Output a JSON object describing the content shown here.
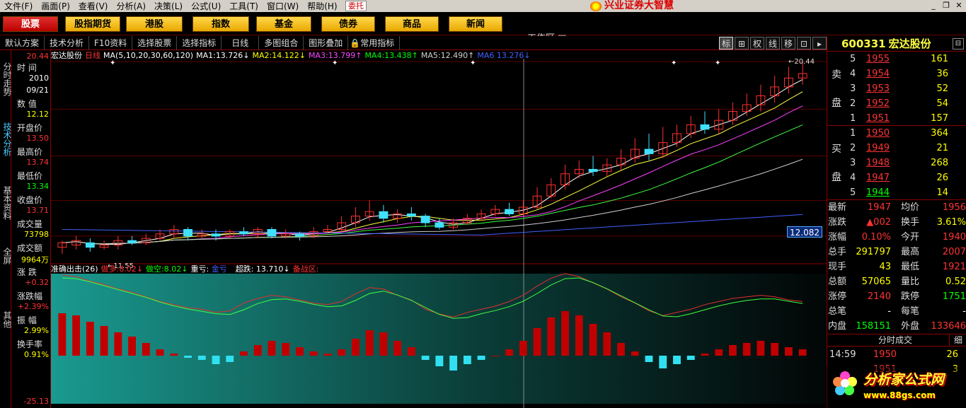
{
  "menu": [
    "文件(F)",
    "画面(P)",
    "查看(V)",
    "分析(A)",
    "决策(L)",
    "公式(U)",
    "工具(T)",
    "窗口(W)",
    "帮助(H)"
  ],
  "menu_weituo": "委托",
  "brand": "兴业证券大智慧",
  "window_buttons": {
    "min": "_",
    "restore": "❐",
    "close": "✕"
  },
  "quick_buttons": [
    "股票",
    "股指期货",
    "港股",
    "指数",
    "基金",
    "债券",
    "商品",
    "新闻"
  ],
  "workzone": "工作区 ▣",
  "toolbar": {
    "items": [
      "默认方案",
      "技术分析",
      "F10资料",
      "选择股票",
      "选择指标",
      "日线",
      "多图组合",
      "图形叠加",
      "常用指标"
    ],
    "right_buttons": [
      "标",
      "⊞",
      "权",
      "线",
      "移",
      "⊡",
      "▸"
    ]
  },
  "left_tabs": [
    "分时走势",
    "技术分析",
    "基本资料",
    "全屏",
    "其他"
  ],
  "sidebar": {
    "top_value": "20.44",
    "time_label": "时  间",
    "year": "2010",
    "date": "09/21",
    "value_label": "数  值",
    "value": "12.12",
    "open_label": "开盘价",
    "open": "13.50",
    "high_label": "最高价",
    "high": "13.74",
    "low_label": "最低价",
    "low": "13.34",
    "close_label": "收盘价",
    "close": "13.71",
    "volume_label": "成交量",
    "volume": "73798",
    "amount_label": "成交额",
    "amount": "9964万",
    "change_label": "涨  跌",
    "change": "+0.32",
    "changepct_label": "涨跌幅",
    "changepct": "+2.39%",
    "amplitude_label": "振  幅",
    "amplitude": "2.99%",
    "turnover_label": "换手率",
    "turnover": "0.91%",
    "bottom_value": "-25.13"
  },
  "chart_header": {
    "stock": "宏达股份",
    "period": "日线",
    "ma_params": "MA(5,10,20,30,60,120)",
    "ma": [
      {
        "label": "MA1:",
        "value": "13.726",
        "arrow": "↓",
        "color": "#ffffff"
      },
      {
        "label": "MA2:",
        "value": "14.122",
        "arrow": "↓",
        "color": "#ffff40"
      },
      {
        "label": "MA3:",
        "value": "13.799",
        "arrow": "↑",
        "color": "#ff40ff"
      },
      {
        "label": "MA4:",
        "value": "13.438",
        "arrow": "↑",
        "color": "#40ff40"
      },
      {
        "label": "MA5:",
        "value": "12.490",
        "arrow": "↑",
        "color": "#d0d0d0"
      },
      {
        "label": "MA6",
        "value": "13.276",
        "arrow": "↓",
        "color": "#4060ff"
      }
    ],
    "high_mark": "20.44",
    "low_mark": "11.55",
    "price_box": "12.082"
  },
  "indicator_header": {
    "name": "准确出击(26)",
    "items": [
      {
        "label": "做多:",
        "value": "8.02",
        "arrow": "↓",
        "color": "#ff3030"
      },
      {
        "label": "做空:",
        "value": "8.02",
        "arrow": "↓",
        "color": "#30ff30"
      },
      {
        "label": "重亏:",
        "value": "金亏",
        "arrow": "",
        "color": "#4060ff"
      },
      {
        "label": "超跌:",
        "value": "13.710",
        "arrow": "↓",
        "color": "#ffffff"
      },
      {
        "label": "备战区:",
        "value": "",
        "arrow": "",
        "color": "#ff3030"
      }
    ]
  },
  "right_panel": {
    "code": "600331",
    "name": "宏达股份",
    "sell_label": [
      "卖",
      "盘"
    ],
    "buy_label": [
      "买",
      "盘"
    ],
    "asks": [
      {
        "level": "5",
        "price": "1955",
        "vol": "161"
      },
      {
        "level": "4",
        "price": "1954",
        "vol": "36"
      },
      {
        "level": "3",
        "price": "1953",
        "vol": "52"
      },
      {
        "level": "2",
        "price": "1952",
        "vol": "54"
      },
      {
        "level": "1",
        "price": "1951",
        "vol": "157"
      }
    ],
    "bids": [
      {
        "level": "1",
        "price": "1950",
        "vol": "364"
      },
      {
        "level": "2",
        "price": "1949",
        "vol": "21"
      },
      {
        "level": "3",
        "price": "1948",
        "vol": "268"
      },
      {
        "level": "4",
        "price": "1947",
        "vol": "26"
      },
      {
        "level": "5",
        "price": "1944",
        "vol": "14"
      }
    ],
    "quote": [
      {
        "l1": "最新",
        "v1": "1947",
        "c1": "red",
        "l2": "均价",
        "v2": "1956",
        "c2": "red"
      },
      {
        "l1": "涨跌",
        "v1": "▲002",
        "c1": "red",
        "l2": "换手",
        "v2": "3.61%",
        "c2": "yel"
      },
      {
        "l1": "涨幅",
        "v1": "0.10%",
        "c1": "red",
        "l2": "今开",
        "v2": "1940",
        "c2": "red"
      },
      {
        "l1": "总手",
        "v1": "291797",
        "c1": "yel",
        "l2": "最高",
        "v2": "2007",
        "c2": "red"
      },
      {
        "l1": "现手",
        "v1": "43",
        "c1": "yel",
        "l2": "最低",
        "v2": "1921",
        "c2": "red"
      },
      {
        "l1": "总额",
        "v1": "57065",
        "c1": "yel",
        "l2": "量比",
        "v2": "0.52",
        "c2": "yel"
      },
      {
        "l1": "涨停",
        "v1": "2140",
        "c1": "red",
        "l2": "跌停",
        "v2": "1751",
        "c2": "grn"
      },
      {
        "l1": "总笔",
        "v1": "-",
        "c1": "wht",
        "l2": "每笔",
        "v2": "-",
        "c2": "wht"
      },
      {
        "l1": "内盘",
        "v1": "158151",
        "c1": "grn",
        "l2": "外盘",
        "v2": "133646",
        "c2": "red"
      }
    ],
    "tick_title": "分时成交",
    "tick_detail": "细",
    "ticks": [
      {
        "time": "14:59",
        "price": "1950",
        "vol": "26"
      },
      {
        "time": "",
        "price": "1951",
        "vol": "3"
      }
    ]
  },
  "watermark": {
    "title": "分析家公式网",
    "url": "www.88gs.com"
  },
  "colors": {
    "up": "#ff3030",
    "down": "#40e0ff",
    "ma1": "#ffffff",
    "ma2": "#ffff40",
    "ma3": "#ff40ff",
    "ma4": "#40ff40",
    "ma5": "#d0d0d0",
    "ma6": "#4060ff",
    "bg": "#000000"
  },
  "chart_data": {
    "type": "candlestick+macd",
    "candles": [
      {
        "o": 12.1,
        "c": 12.3,
        "h": 12.4,
        "l": 11.8
      },
      {
        "o": 12.2,
        "c": 12.4,
        "h": 12.6,
        "l": 12.0
      },
      {
        "o": 12.3,
        "c": 12.1,
        "h": 12.5,
        "l": 11.9
      },
      {
        "o": 12.1,
        "c": 12.2,
        "h": 12.4,
        "l": 12.0
      },
      {
        "o": 12.2,
        "c": 12.4,
        "h": 12.6,
        "l": 12.0
      },
      {
        "o": 12.4,
        "c": 12.3,
        "h": 12.6,
        "l": 12.2
      },
      {
        "o": 12.3,
        "c": 12.5,
        "h": 12.7,
        "l": 12.2
      },
      {
        "o": 12.5,
        "c": 12.7,
        "h": 12.9,
        "l": 12.4
      },
      {
        "o": 12.7,
        "c": 12.9,
        "h": 13.1,
        "l": 12.5
      },
      {
        "o": 12.9,
        "c": 12.6,
        "h": 13.0,
        "l": 12.4
      },
      {
        "o": 12.6,
        "c": 12.7,
        "h": 12.9,
        "l": 12.5
      },
      {
        "o": 12.7,
        "c": 12.6,
        "h": 12.9,
        "l": 12.4
      },
      {
        "o": 12.6,
        "c": 12.8,
        "h": 12.9,
        "l": 12.5
      },
      {
        "o": 12.8,
        "c": 12.7,
        "h": 13.0,
        "l": 12.6
      },
      {
        "o": 12.7,
        "c": 12.9,
        "h": 13.0,
        "l": 12.5
      },
      {
        "o": 12.9,
        "c": 12.6,
        "h": 13.0,
        "l": 12.5
      },
      {
        "o": 12.6,
        "c": 12.7,
        "h": 12.9,
        "l": 12.5
      },
      {
        "o": 12.7,
        "c": 12.6,
        "h": 12.8,
        "l": 12.4
      },
      {
        "o": 12.6,
        "c": 12.8,
        "h": 13.0,
        "l": 12.5
      },
      {
        "o": 12.8,
        "c": 12.9,
        "h": 13.1,
        "l": 12.7
      },
      {
        "o": 12.9,
        "c": 13.2,
        "h": 13.5,
        "l": 12.8
      },
      {
        "o": 13.2,
        "c": 13.5,
        "h": 13.9,
        "l": 13.0
      },
      {
        "o": 13.5,
        "c": 13.7,
        "h": 14.2,
        "l": 13.3
      },
      {
        "o": 13.7,
        "c": 13.4,
        "h": 14.0,
        "l": 13.2
      },
      {
        "o": 13.4,
        "c": 13.6,
        "h": 13.8,
        "l": 13.2
      },
      {
        "o": 13.6,
        "c": 13.5,
        "h": 13.9,
        "l": 13.3
      },
      {
        "o": 13.5,
        "c": 13.2,
        "h": 13.6,
        "l": 13.0
      },
      {
        "o": 13.2,
        "c": 13.0,
        "h": 13.4,
        "l": 12.9
      },
      {
        "o": 13.0,
        "c": 13.2,
        "h": 13.4,
        "l": 12.9
      },
      {
        "o": 13.2,
        "c": 13.4,
        "h": 13.6,
        "l": 13.1
      },
      {
        "o": 13.4,
        "c": 13.6,
        "h": 13.8,
        "l": 13.3
      },
      {
        "o": 13.6,
        "c": 13.8,
        "h": 14.0,
        "l": 13.5
      },
      {
        "o": 13.8,
        "c": 13.6,
        "h": 14.1,
        "l": 13.5
      },
      {
        "o": 13.6,
        "c": 13.9,
        "h": 14.2,
        "l": 13.5
      },
      {
        "o": 13.9,
        "c": 14.4,
        "h": 14.8,
        "l": 13.8
      },
      {
        "o": 14.4,
        "c": 14.9,
        "h": 15.2,
        "l": 14.3
      },
      {
        "o": 14.9,
        "c": 15.4,
        "h": 15.8,
        "l": 14.7
      },
      {
        "o": 15.4,
        "c": 15.6,
        "h": 16.0,
        "l": 15.2
      },
      {
        "o": 15.6,
        "c": 15.5,
        "h": 16.2,
        "l": 15.3
      },
      {
        "o": 15.5,
        "c": 15.8,
        "h": 16.1,
        "l": 15.3
      },
      {
        "o": 15.8,
        "c": 16.1,
        "h": 16.5,
        "l": 15.6
      },
      {
        "o": 16.1,
        "c": 16.5,
        "h": 17.0,
        "l": 15.9
      },
      {
        "o": 16.5,
        "c": 16.3,
        "h": 17.2,
        "l": 16.0
      },
      {
        "o": 16.3,
        "c": 16.8,
        "h": 17.5,
        "l": 16.1
      },
      {
        "o": 16.8,
        "c": 17.2,
        "h": 17.6,
        "l": 16.6
      },
      {
        "o": 17.2,
        "c": 17.6,
        "h": 18.0,
        "l": 17.0
      },
      {
        "o": 17.6,
        "c": 17.4,
        "h": 18.2,
        "l": 17.2
      },
      {
        "o": 17.4,
        "c": 17.8,
        "h": 18.3,
        "l": 17.2
      },
      {
        "o": 17.8,
        "c": 18.2,
        "h": 18.6,
        "l": 17.6
      },
      {
        "o": 18.2,
        "c": 18.5,
        "h": 19.0,
        "l": 18.0
      },
      {
        "o": 18.5,
        "c": 18.9,
        "h": 19.4,
        "l": 18.2
      },
      {
        "o": 18.9,
        "c": 19.3,
        "h": 19.8,
        "l": 18.6
      },
      {
        "o": 19.3,
        "c": 19.7,
        "h": 20.2,
        "l": 19.0
      },
      {
        "o": 19.7,
        "c": 19.9,
        "h": 20.44,
        "l": 19.4
      }
    ],
    "macd_hist": [
      2.0,
      1.9,
      1.6,
      1.4,
      1.1,
      0.9,
      0.6,
      0.3,
      0.1,
      -0.1,
      -0.2,
      -0.4,
      -0.3,
      0.2,
      0.5,
      0.7,
      0.6,
      0.4,
      0.2,
      0.1,
      0.3,
      0.8,
      1.2,
      1.1,
      0.7,
      0.4,
      -0.2,
      -0.5,
      -0.7,
      -0.4,
      -0.2,
      0.0,
      0.3,
      0.7,
      1.3,
      1.8,
      2.1,
      1.9,
      1.5,
      1.1,
      0.6,
      0.2,
      -0.3,
      -0.6,
      -0.4,
      -0.2,
      0.1,
      0.3,
      0.5,
      0.6,
      0.7,
      0.6,
      0.4,
      0.3
    ],
    "ylim": [
      11.55,
      20.44
    ]
  }
}
